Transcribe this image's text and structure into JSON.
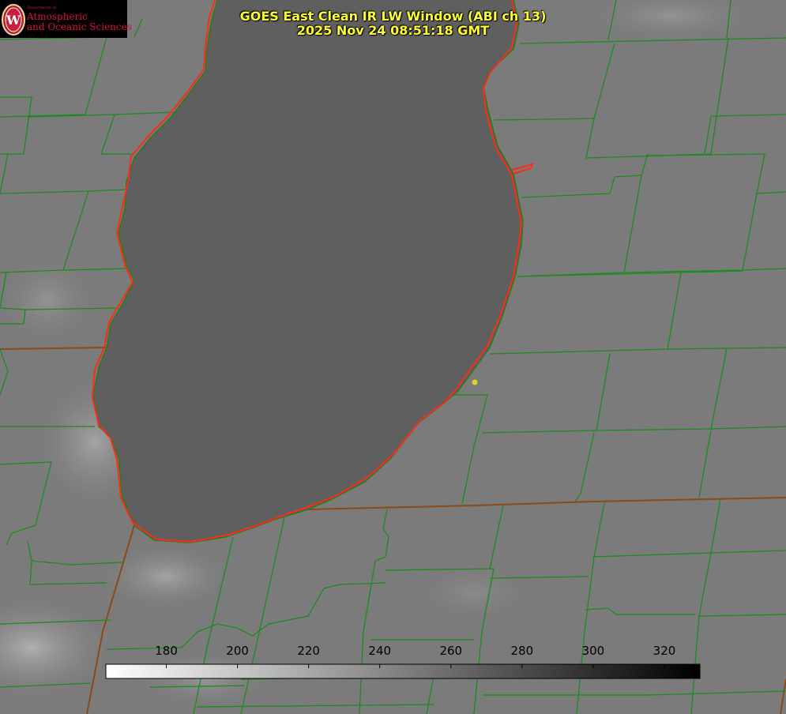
{
  "title": {
    "line1": "GOES East Clean IR LW Window (ABI ch 13)",
    "line2": "2025 Nov 24 08:51:18 GMT"
  },
  "logo": {
    "department": "Department of",
    "line1": "Atmospheric",
    "line2": "and Oceanic Sciences",
    "crest_letter": "W",
    "icon": "uw-crest-icon"
  },
  "colorbar": {
    "ticks": [
      "180",
      "200",
      "220",
      "240",
      "260",
      "280",
      "300",
      "320"
    ],
    "min": 163,
    "max": 330,
    "gradient": "white-to-black"
  },
  "colors": {
    "land": "#7b7b7b",
    "lake": "#5f5f5f",
    "county_lines": "#1e8a1e",
    "state_lines": "#8a4a1a",
    "coast_lines": "#ff2a1a",
    "title_text": "#ffff33",
    "marker": "#e0d020"
  }
}
